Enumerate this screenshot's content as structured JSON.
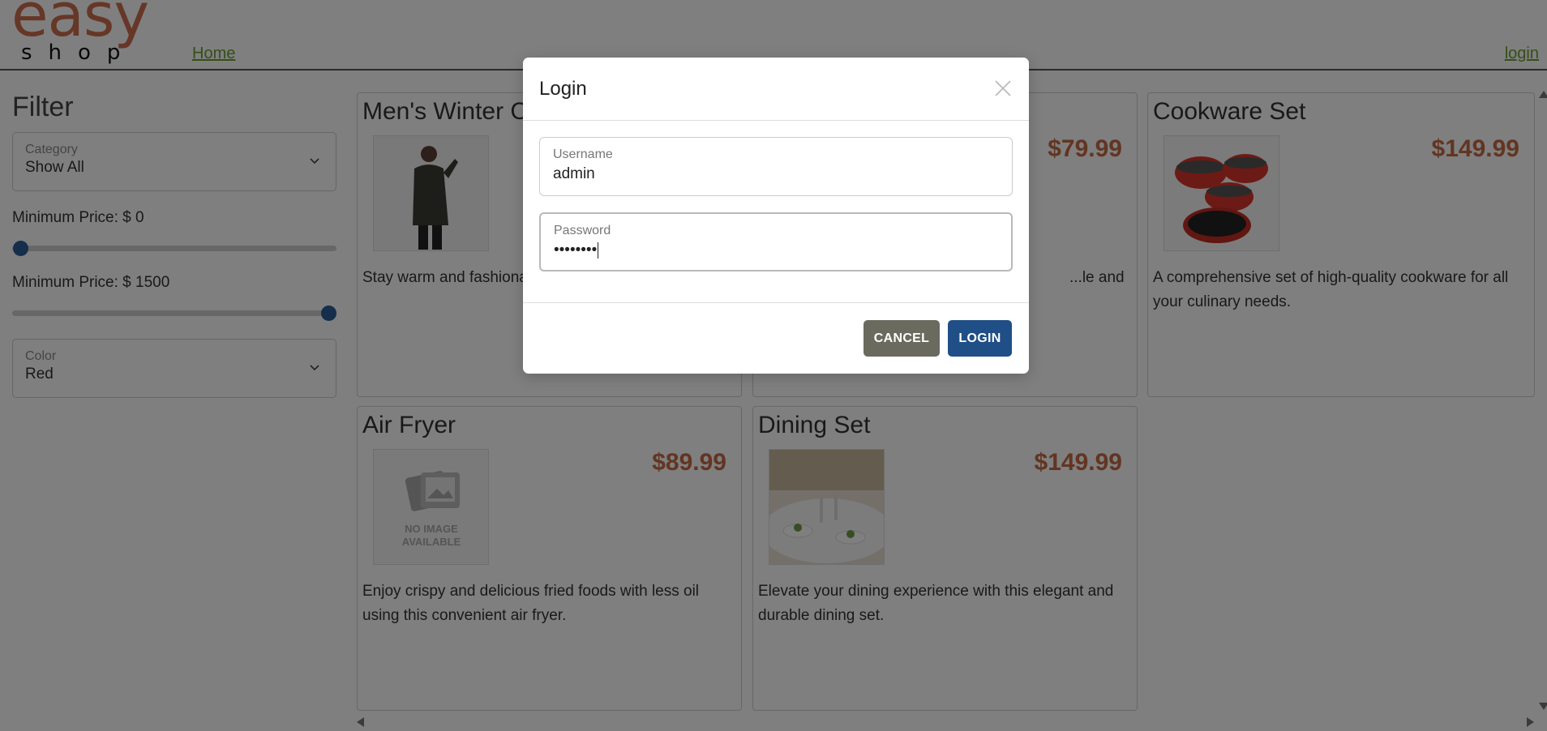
{
  "header": {
    "logo_top": "easy",
    "logo_bottom": "shop",
    "nav_home": "Home",
    "nav_login": "login"
  },
  "filter": {
    "title": "Filter",
    "category_label": "Category",
    "category_value": "Show All",
    "min_price_label": "Minimum Price: $ 0",
    "max_price_label": "Minimum Price: $ 1500",
    "min_price_level": 0,
    "max_price_level": 1,
    "color_label": "Color",
    "color_value": "Red"
  },
  "products": [
    {
      "name": "Men's Winter Coat",
      "price": "",
      "desc": "Stay warm and fashionable this season with this coat.",
      "image": "coat-photo"
    },
    {
      "name": "",
      "price": "$79.99",
      "desc": "...le and",
      "image": "hidden"
    },
    {
      "name": "Cookware Set",
      "price": "$149.99",
      "desc": "A comprehensive set of high-quality cookware for all your culinary needs.",
      "image": "cookware-photo"
    },
    {
      "name": "Air Fryer",
      "price": "$89.99",
      "desc": "Enjoy crispy and delicious fried foods with less oil using this convenient air fryer.",
      "image": "no-image"
    },
    {
      "name": "Dining Set",
      "price": "$149.99",
      "desc": "Elevate your dining experience with this elegant and durable dining set.",
      "image": "dining-photo"
    }
  ],
  "placeholder": {
    "line1": "NO IMAGE",
    "line2": "AVAILABLE"
  },
  "modal": {
    "title": "Login",
    "username_label": "Username",
    "username_value": "admin",
    "password_label": "Password",
    "password_value": "••••••••",
    "cancel_label": "CANCEL",
    "login_label": "LOGIN"
  },
  "colors": {
    "accent_orange": "#c46b45",
    "link_green": "#6b9f2c",
    "primary_blue": "#1f4f86",
    "cancel_gray": "#6b6a5f"
  }
}
